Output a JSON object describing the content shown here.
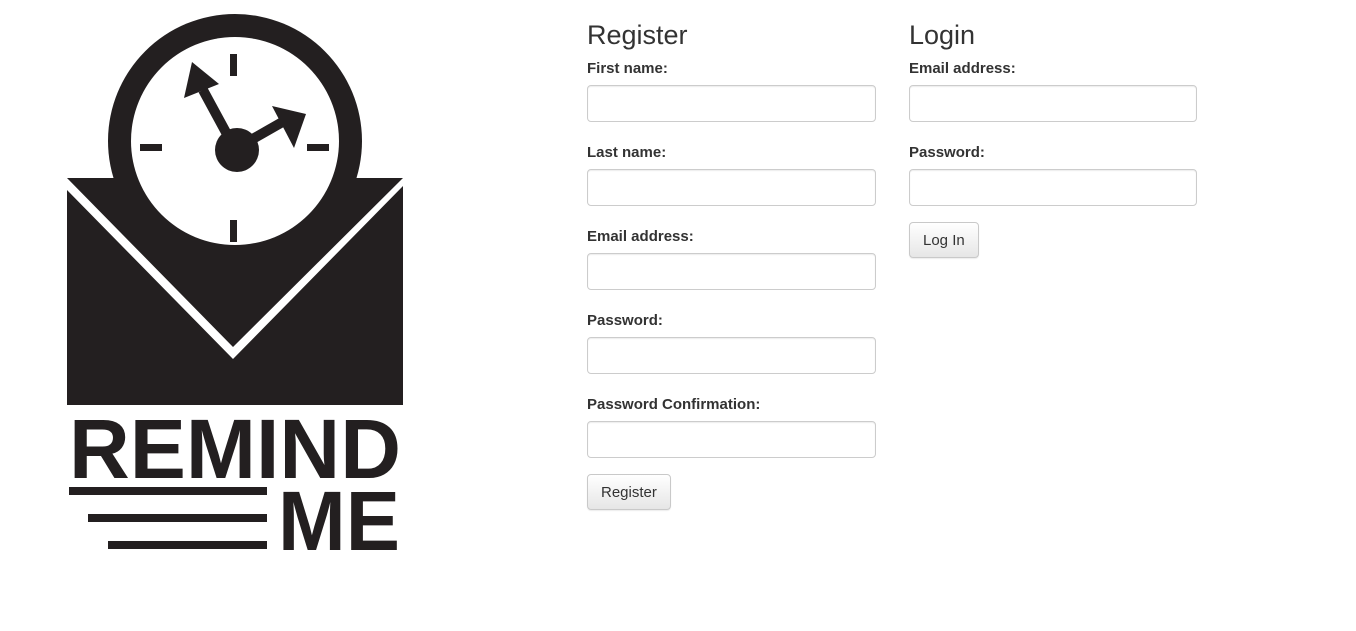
{
  "logo": {
    "line1": "REMIND",
    "line2": "ME",
    "color": "#231f20"
  },
  "register": {
    "heading": "Register",
    "first_name_label": "First name:",
    "last_name_label": "Last name:",
    "email_label": "Email address:",
    "password_label": "Password:",
    "password_confirmation_label": "Password Confirmation:",
    "submit_label": "Register"
  },
  "login": {
    "heading": "Login",
    "email_label": "Email address:",
    "password_label": "Password:",
    "submit_label": "Log In"
  }
}
